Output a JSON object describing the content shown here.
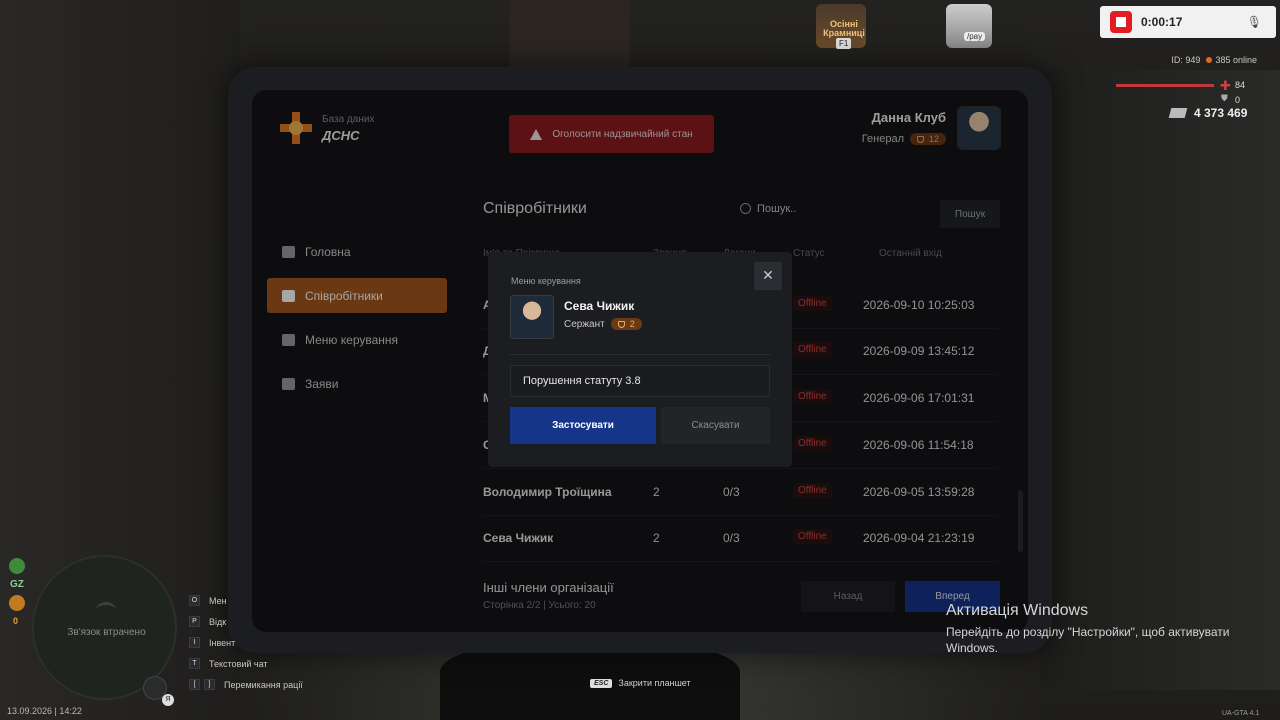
{
  "hud": {
    "record_time": "0:00:17",
    "autumn_event": "Осінні Крамниці",
    "autumn_key": "F1",
    "car_label": "/pay",
    "player_id": "ID: 949",
    "online": "385 online",
    "health": "84",
    "armor": "0",
    "money": "4 373 469",
    "gz_label": "GZ",
    "x_count": "0",
    "minimap_status": "Зв'язок втрачено",
    "mic_key": "Я",
    "datetime": "13.09.2026 | 14:22",
    "esc_key": "ESC",
    "esc_label": "Закрити планшет",
    "version": "UA-GTA 4.1",
    "keybinds": [
      {
        "key": "O",
        "label": "Мен"
      },
      {
        "key": "P",
        "label": "Відк"
      },
      {
        "key": "I",
        "label": "Інвент"
      },
      {
        "key": "T",
        "label": "Текстовий чат"
      },
      {
        "key": "[",
        "key2": "]",
        "label": "Перемикання рації"
      }
    ]
  },
  "tablet": {
    "brand_sub": "База даних",
    "brand_name": "ДСНС",
    "emergency_label": "Оголосити надзвичайний стан",
    "user": {
      "name": "Данна Клуб",
      "rank": "Генерал",
      "rank_level": "12"
    },
    "nav": [
      {
        "label": "Головна",
        "icon": "home-icon"
      },
      {
        "label": "Співробітники",
        "icon": "users-icon",
        "active": true
      },
      {
        "label": "Меню керування",
        "icon": "gear-icon"
      },
      {
        "label": "Заяви",
        "icon": "folder-icon"
      }
    ],
    "section_title": "Співробітники",
    "search_placeholder": "Пошук..",
    "search_button": "Пошук",
    "columns": {
      "name": "Ім'я та Прізвище",
      "rank": "Звання",
      "warns": "Догани",
      "status": "Статус",
      "last": "Останній вхід"
    },
    "rows": [
      {
        "name": "А",
        "rank": "",
        "warns": "",
        "status": "Offline",
        "last": "2026-09-10 10:25:03"
      },
      {
        "name": "Д",
        "rank": "",
        "warns": "",
        "status": "Offline",
        "last": "2026-09-09 13:45:12"
      },
      {
        "name": "М",
        "rank": "",
        "warns": "",
        "status": "Offline",
        "last": "2026-09-06 17:01:31"
      },
      {
        "name": "С",
        "rank": "",
        "warns": "",
        "status": "Offline",
        "last": "2026-09-06 11:54:18"
      },
      {
        "name": "Володимир Троїщина",
        "rank": "2",
        "warns": "0/3",
        "status": "Offline",
        "last": "2026-09-05 13:59:28"
      },
      {
        "name": "Сева Чижик",
        "rank": "2",
        "warns": "0/3",
        "status": "Offline",
        "last": "2026-09-04 21:23:19"
      }
    ],
    "other_title": "Інші члени організації",
    "pager": "Сторінка 2/2 | Усього: 20",
    "back_label": "Назад",
    "next_label": "Вперед"
  },
  "modal": {
    "title": "Меню керування",
    "name": "Сева Чижик",
    "rank": "Сержант",
    "rank_level": "2",
    "reason_value": "Порушення статуту 3.8",
    "apply_label": "Застосувати",
    "cancel_label": "Скасувати"
  },
  "activation": {
    "title": "Активація Windows",
    "text": "Перейдіть до розділу \"Настройки\", щоб активувати Windows."
  },
  "colors": {
    "accent_orange": "#a3561c",
    "primary_blue": "#16348a",
    "danger_red": "#8e1d20",
    "offline_red": "#d6453f"
  }
}
